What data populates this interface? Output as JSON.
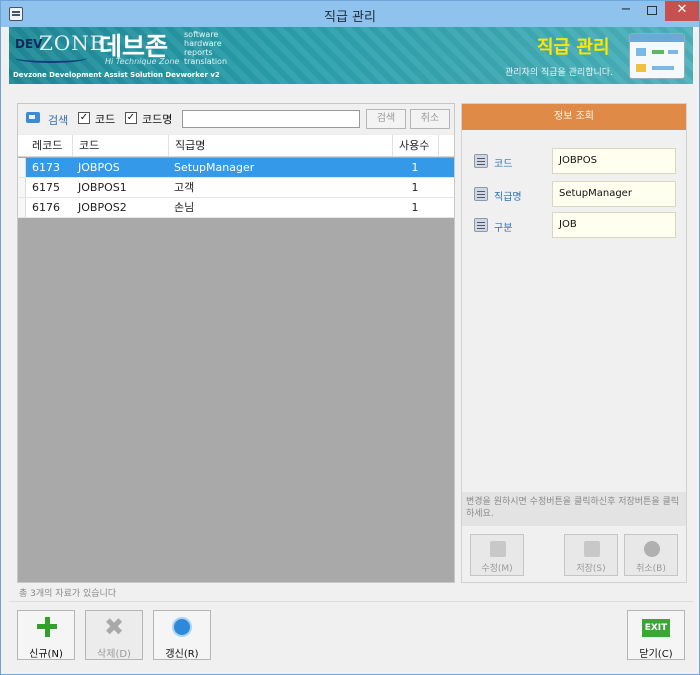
{
  "window": {
    "title": "직급 관리",
    "min_label": "−",
    "close_label": "✕"
  },
  "banner": {
    "dev": "DEV",
    "zone": "ZONE",
    "brand_ko": "데브존",
    "brand_sub": "Hi Technique Zone",
    "brand_lines": [
      "software",
      "hardware",
      "reports",
      "translation"
    ],
    "footer": "Devzone Development Assist Solution Devworker v2",
    "heading": "직급 관리",
    "description": "관리자의 직급을 관리합니다."
  },
  "search": {
    "label": "검색",
    "code_checkbox_label": "코드",
    "code_checked": true,
    "name_checkbox_label": "코드명",
    "name_checked": true,
    "input_value": "",
    "search_button": "검색",
    "cancel_button": "취소",
    "checkmark": "✓"
  },
  "grid": {
    "columns": [
      "레코드",
      "코드",
      "직급명",
      "사용수"
    ],
    "rows": [
      {
        "record": "6173",
        "code": "JOBPOS",
        "name": "SetupManager",
        "usage": "1",
        "selected": true
      },
      {
        "record": "6175",
        "code": "JOBPOS1",
        "name": "고객",
        "usage": "1",
        "selected": false
      },
      {
        "record": "6176",
        "code": "JOBPOS2",
        "name": "손님",
        "usage": "1",
        "selected": false
      }
    ]
  },
  "status": "총 3개의 자료가 있습니다",
  "detail": {
    "header": "정보 조회",
    "fields": [
      {
        "label": "코드",
        "value": "JOBPOS"
      },
      {
        "label": "직급명",
        "value": "SetupManager"
      },
      {
        "label": "구분",
        "value": "JOB"
      }
    ],
    "hint": "변경을 원하시면 수정버튼을 클릭하신후 저장버튼을 클릭하세요.",
    "edit_button": "수정(M)",
    "save_button": "저장(S)",
    "cancel_button": "취소(B)"
  },
  "toolbar": {
    "new_button": "신규(N)",
    "delete_button": "삭제(D)",
    "refresh_button": "갱신(R)",
    "exit_icon_text": "EXIT",
    "close_button": "닫기(C)"
  },
  "colors": {
    "title_bar": "#8fc3ee",
    "banner_teal": "#2aa0ac",
    "heading_yellow": "#ffe600",
    "selected_row": "#3399e8",
    "detail_header": "#e08a48",
    "field_bg": "#fffff0"
  }
}
